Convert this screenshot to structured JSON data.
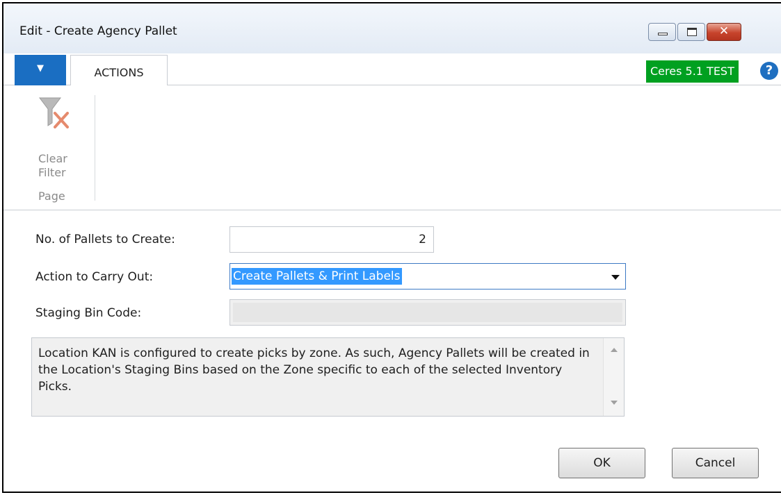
{
  "window": {
    "title": "Edit - Create Agency Pallet",
    "close_glyph": "✕"
  },
  "ribbon_tabs": {
    "menu_glyph": "▼",
    "actions_label": "ACTIONS",
    "environment_badge": "Ceres 5.1 TEST",
    "help_glyph": "?"
  },
  "ribbon": {
    "clear_filter_label_line1": "Clear",
    "clear_filter_label_line2": "Filter",
    "group_label": "Page"
  },
  "form": {
    "pallets_label": "No. of Pallets to Create:",
    "pallets_value": "2",
    "action_label": "Action to Carry Out:",
    "action_value": "Create Pallets & Print Labels",
    "staging_label": "Staging Bin Code:",
    "staging_value": ""
  },
  "info": {
    "message": "Location KAN is configured to create picks by zone. As such, Agency Pallets will be created in the Location's Staging Bins based on the Zone specific to each of the selected Inventory Picks."
  },
  "buttons": {
    "ok_label": "OK",
    "cancel_label": "Cancel"
  },
  "colors": {
    "accent_blue": "#1a6ec2",
    "environment_green": "#00a020",
    "selection_blue": "#3399ff"
  }
}
